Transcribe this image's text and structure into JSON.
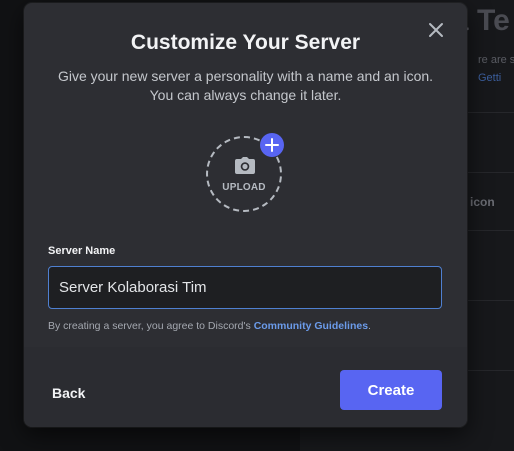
{
  "background": {
    "heading": "a Te",
    "line1": "re are sc",
    "line2_link": "Getti",
    "icon_text": "icon"
  },
  "modal": {
    "close_icon": "close-icon",
    "title": "Customize Your Server",
    "subtitle": "Give your new server a personality with a name and an icon. You can always change it later.",
    "upload": {
      "label": "UPLOAD",
      "icon": "camera-icon",
      "add_icon": "plus-icon"
    },
    "server_name": {
      "label": "Server Name",
      "value": "Server Kolaborasi Tim"
    },
    "legal": {
      "prefix": "By creating a server, you agree to Discord's ",
      "link": "Community Guidelines",
      "suffix": "."
    },
    "footer": {
      "back_label": "Back",
      "create_label": "Create"
    }
  },
  "colors": {
    "accent": "#5865f2",
    "link": "#6b9bea",
    "input_focus_border": "#4f80d1"
  }
}
